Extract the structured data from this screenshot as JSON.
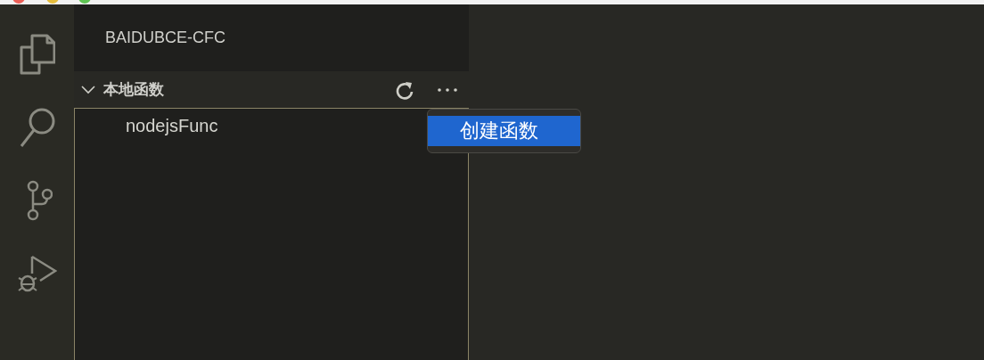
{
  "sidebar": {
    "title": "BAIDUBCE-CFC",
    "section": {
      "title": "本地函数",
      "expanded": true,
      "items": [
        {
          "label": "nodejsFunc"
        }
      ]
    }
  },
  "context_menu": {
    "items": [
      {
        "label": "创建函数",
        "selected": true
      }
    ]
  }
}
